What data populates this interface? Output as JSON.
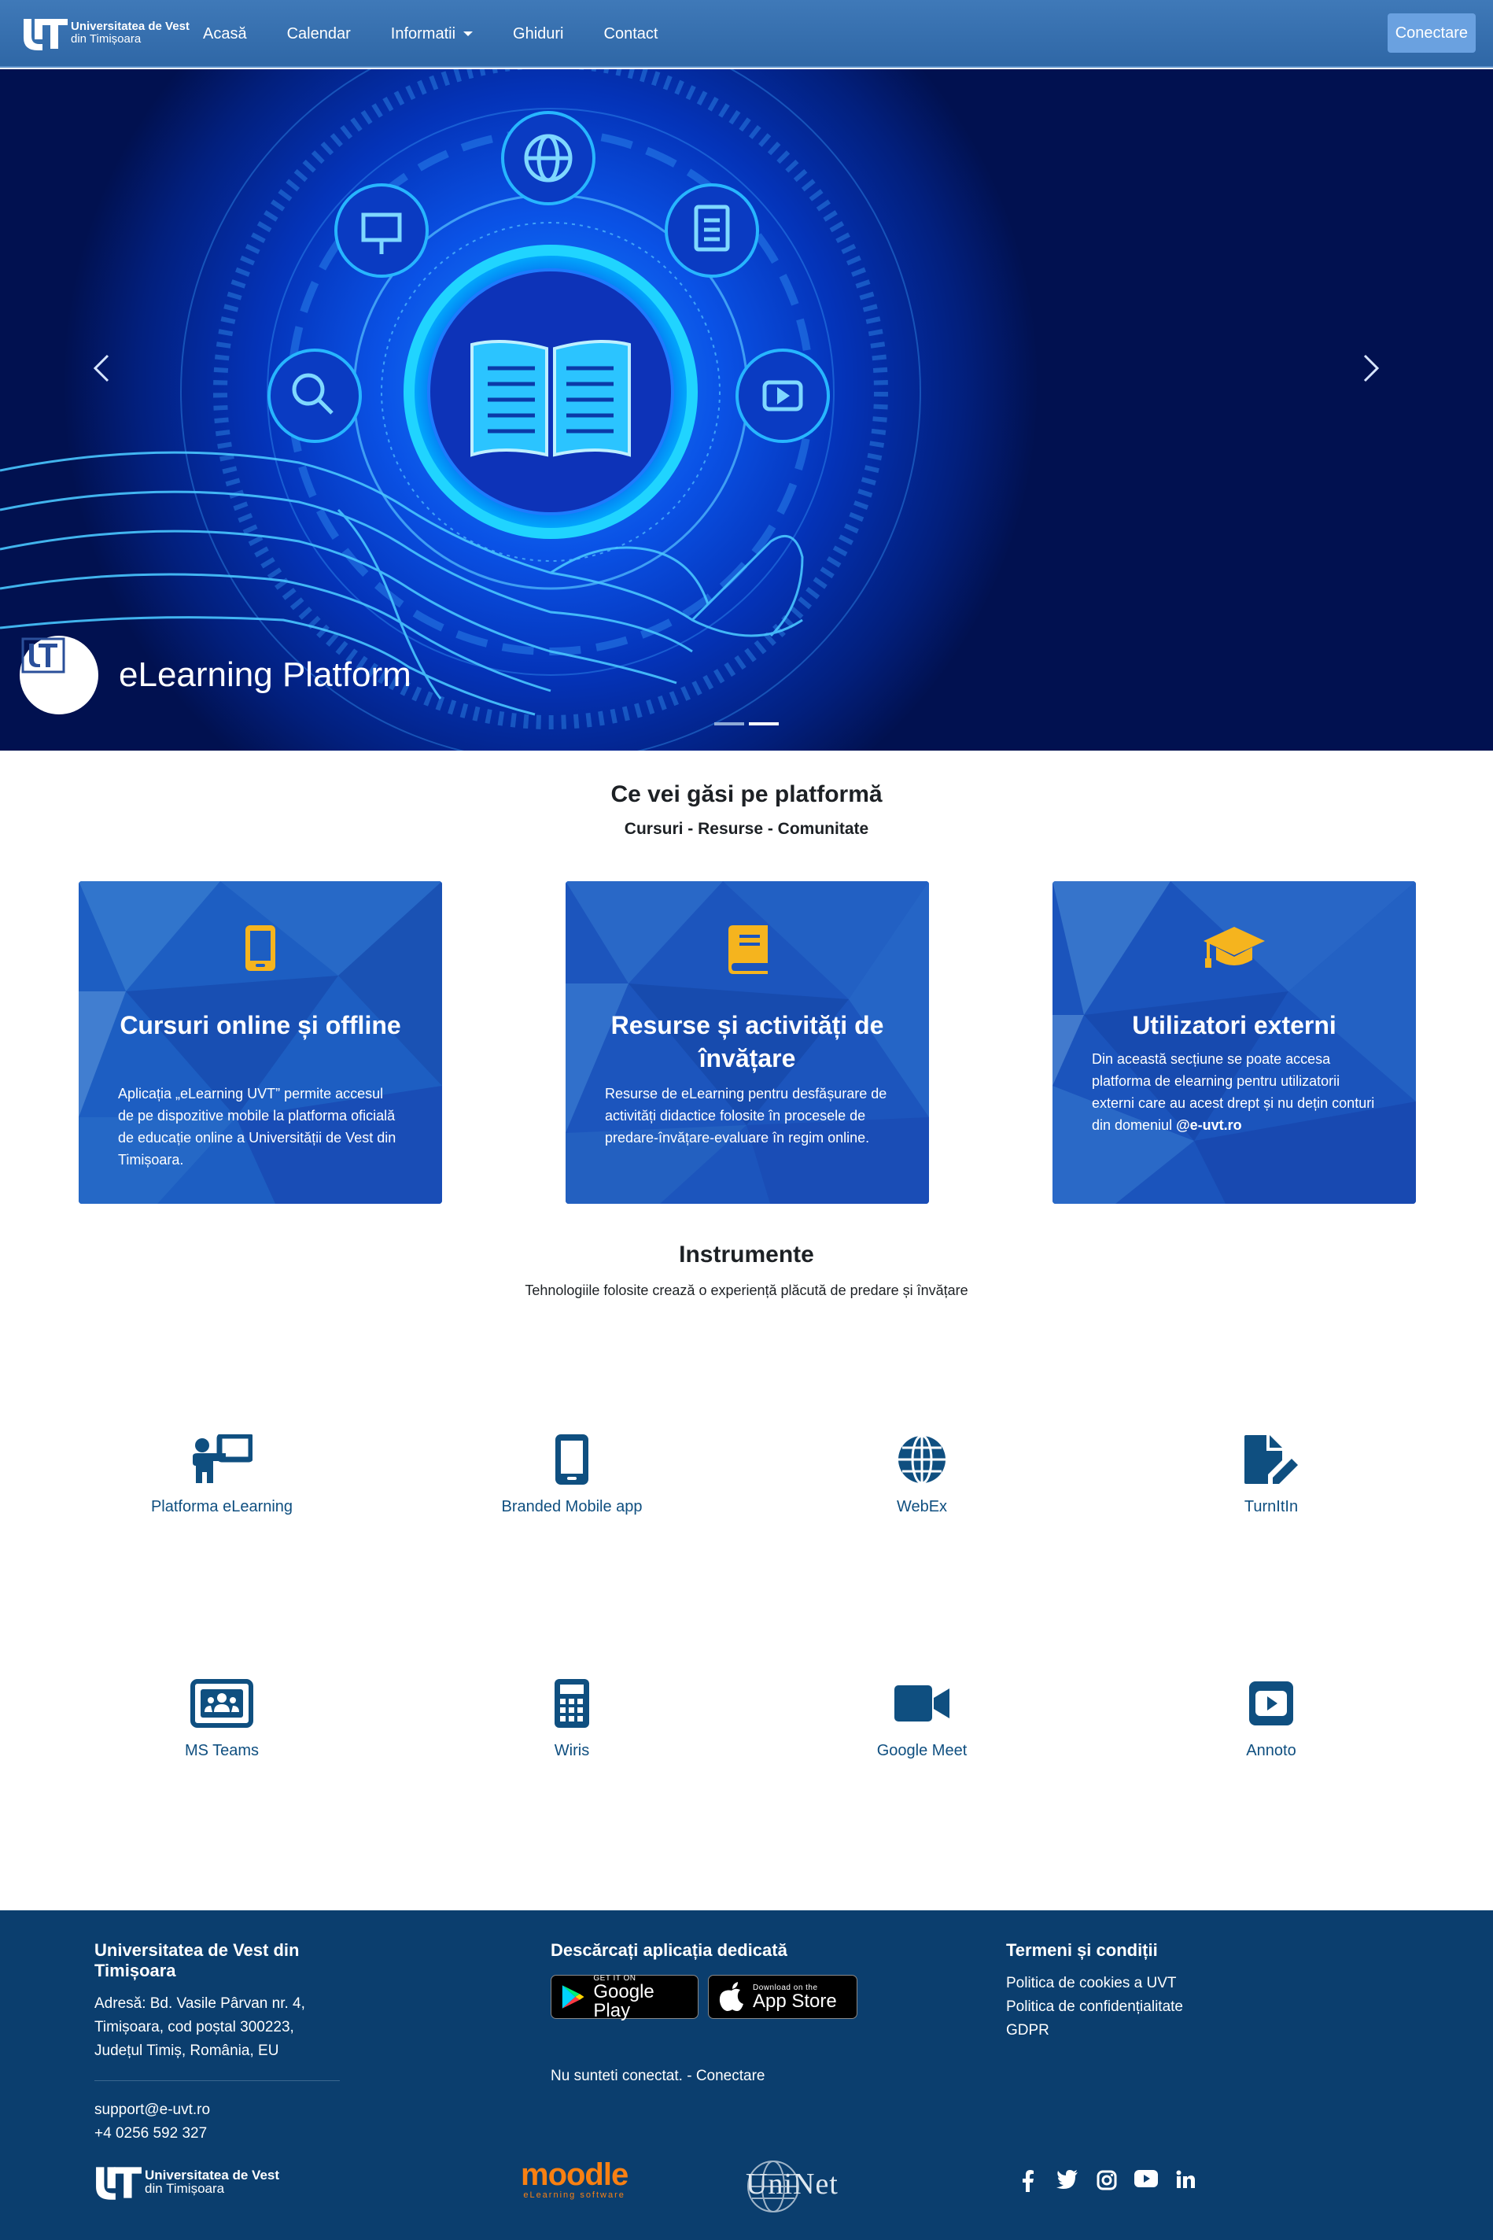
{
  "nav": {
    "brand_line1": "Universitatea de Vest",
    "brand_line2": "din Timișoara",
    "links": [
      "Acasă",
      "Calendar",
      "Informatii",
      "Ghiduri",
      "Contact"
    ],
    "login_label": "Conectare"
  },
  "hero": {
    "caption": "eLearning Platform",
    "prev_icon": "chevron-left-icon",
    "next_icon": "chevron-right-icon"
  },
  "intro": {
    "title": "Ce vei găsi pe platformă",
    "subtitle": "Cursuri - Resurse - Comunitate"
  },
  "cards": [
    {
      "icon": "mobile-icon",
      "title": "Cursuri online și offline",
      "text": "Aplicația „eLearning UVT” permite accesul de pe dispozitive mobile la platforma oficială de educație online a Universității de Vest din Timișoara."
    },
    {
      "icon": "book-icon",
      "title": "Resurse și activități de învățare",
      "text": "Resurse de eLearning pentru desfășurare de activități didactice folosite în procesele de predare-învățare-evaluare în regim online."
    },
    {
      "icon": "graduation-cap-icon",
      "title": "Utilizatori externi",
      "text": "Din această secțiune se poate accesa platforma de elearning pentru utilizatorii externi care au acest drept și nu dețin conturi din domeniul",
      "text_bold": "@e-uvt.ro"
    }
  ],
  "tools_section": {
    "title": "Instrumente",
    "subtitle": "Tehnologiile folosite crează o experiență plăcută de predare și învățare"
  },
  "tools": [
    {
      "label": "Platforma eLearning",
      "icon": "teacher-board-icon"
    },
    {
      "label": "Branded Mobile app",
      "icon": "mobile-icon"
    },
    {
      "label": "WebEx",
      "icon": "globe-icon"
    },
    {
      "label": "TurnItIn",
      "icon": "file-edit-icon"
    },
    {
      "label": "MS Teams",
      "icon": "users-rectangle-icon"
    },
    {
      "label": "Wiris",
      "icon": "calculator-icon"
    },
    {
      "label": "Google Meet",
      "icon": "video-camera-icon"
    },
    {
      "label": "Annoto",
      "icon": "youtube-icon"
    }
  ],
  "footer": {
    "col1_title": "Universitatea de Vest din Timișoara",
    "address": [
      "Adresă: Bd. Vasile Pârvan nr. 4,",
      "Timișoara, cod poștal 300223,",
      "Județul Timiș, România, EU"
    ],
    "email": "support@e-uvt.ro",
    "phone": "+4 0256 592 327",
    "col2_title": "Descărcați aplicația dedicată",
    "google_play_small": "GET IT ON",
    "google_play_big": "Google Play",
    "app_store_small": "Download on the",
    "app_store_big": "App Store",
    "login_status": "Nu sunteti conectat. - Conectare",
    "col3_title": "Termeni și condiții",
    "links": [
      "Politica de cookies a UVT",
      "Politica de confidențialitate",
      "GDPR"
    ],
    "logo_uvt_line1": "Universitatea de Vest",
    "logo_uvt_line2": "din Timișoara",
    "logo_moodle": "moodle",
    "logo_moodle_sub": "eLearning software",
    "logo_uninet": "UniNet",
    "social": [
      "facebook-icon",
      "twitter-icon",
      "instagram-icon",
      "youtube-icon",
      "linkedin-icon"
    ]
  },
  "colors": {
    "nav": "#3a73b2",
    "card_icon": "#f5b41e",
    "tool_icon": "#0f4f80",
    "footer": "#0b3e6e"
  }
}
